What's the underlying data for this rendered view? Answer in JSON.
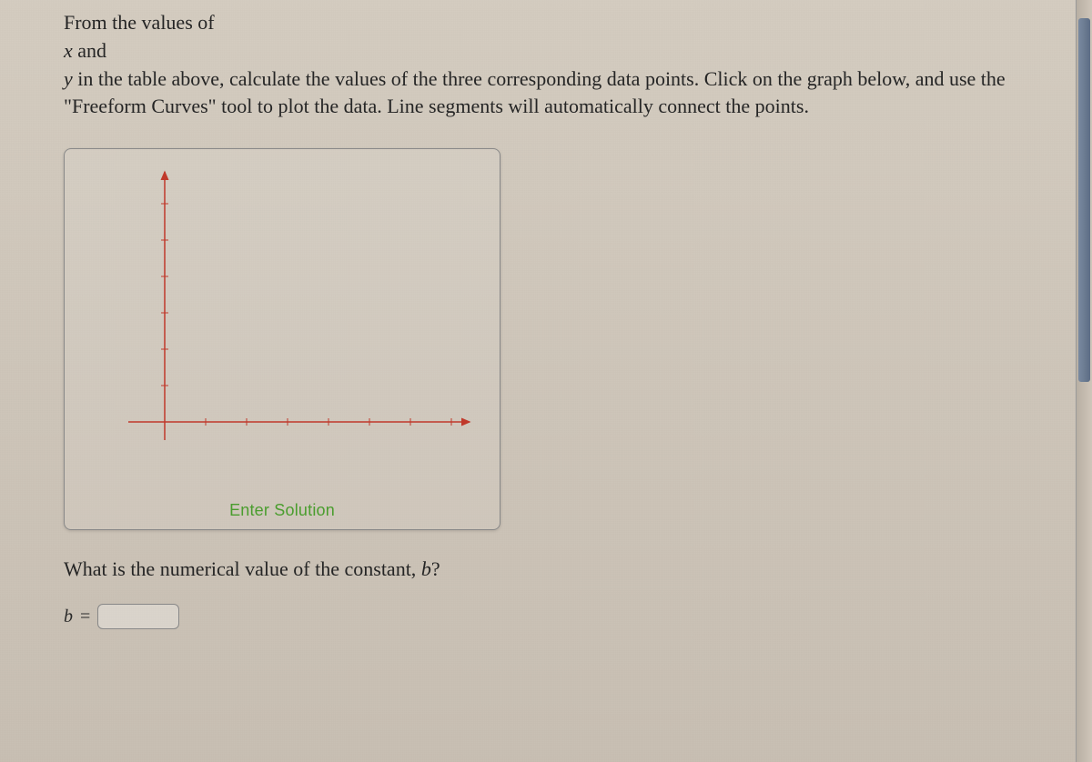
{
  "instructions": {
    "line1_prefix": "From the values of",
    "var_x": "x",
    "line2_mid": " and",
    "var_y": "y",
    "line3_rest": " in the table above, calculate the values of the three corresponding data points. Click on the graph below, and use the \"Freeform Curves\" tool to plot the data. Line segments will automatically connect the points."
  },
  "graph": {
    "enter_solution_label": "Enter Solution"
  },
  "question": {
    "prompt_prefix": "What is the numerical value of the constant, ",
    "var_b": "b",
    "prompt_suffix": "?"
  },
  "answer": {
    "label_var": "b",
    "equals": " = ",
    "value": ""
  },
  "chart_data": {
    "type": "line",
    "title": "",
    "xlabel": "",
    "ylabel": "",
    "x": [],
    "series": [],
    "xlim": [
      0,
      10
    ],
    "ylim": [
      0,
      10
    ],
    "grid": false,
    "note": "Empty first-quadrant Cartesian axes with red arrows; no data points plotted; tick marks shown but unlabeled."
  }
}
